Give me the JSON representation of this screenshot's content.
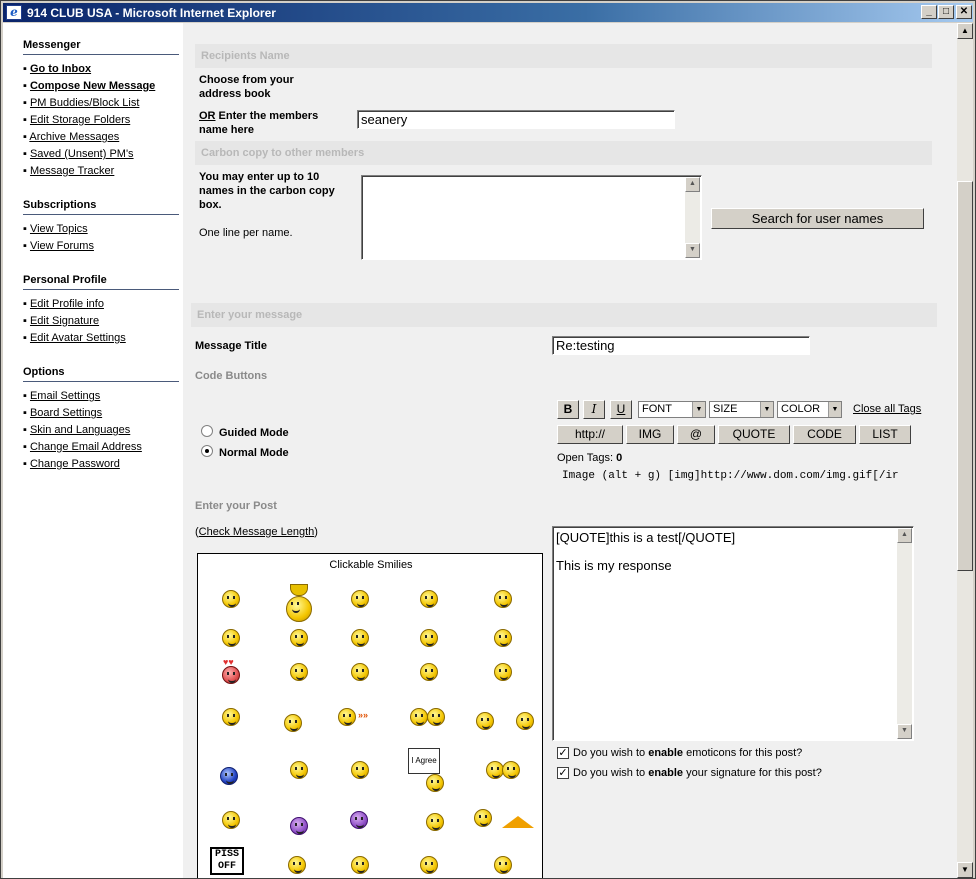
{
  "window": {
    "title": "914 CLUB USA - Microsoft Internet Explorer",
    "min": "_",
    "max": "□",
    "close": "✕"
  },
  "sidebar": {
    "sections": [
      {
        "heading": "Messenger",
        "items": [
          "Go to Inbox",
          "Compose New Message",
          "PM Buddies/Block List",
          "Edit Storage Folders",
          "Archive Messages",
          "Saved (Unsent) PM's",
          "Message Tracker"
        ]
      },
      {
        "heading": "Subscriptions",
        "items": [
          "View Topics",
          "View Forums"
        ]
      },
      {
        "heading": "Personal Profile",
        "items": [
          "Edit Profile info",
          "Edit Signature",
          "Edit Avatar Settings"
        ]
      },
      {
        "heading": "Options",
        "items": [
          "Email Settings",
          "Board Settings",
          "Skin and Languages",
          "Change Email Address",
          "Change Password"
        ]
      }
    ]
  },
  "recipients": {
    "bar": "Recipients Name",
    "choose_line1": "Choose from your",
    "choose_line2": "address book",
    "or": "OR",
    "enter_line1": " Enter the members",
    "enter_line2": "name here",
    "name_value": "seanery"
  },
  "carbon": {
    "bar": "Carbon copy to other members",
    "line1": "You may enter up to 10",
    "line2": "names in the carbon copy",
    "line3": "box.",
    "note": "One line per name.",
    "search_button": "Search for user names"
  },
  "message": {
    "bar": "Enter your message",
    "title_label": "Message Title",
    "title_value": "Re:testing",
    "code_buttons_label": "Code Buttons",
    "guided_mode": "Guided Mode",
    "normal_mode": "Normal Mode",
    "toolbar": {
      "bold": "B",
      "italic": "I",
      "underline": "U",
      "font": "FONT",
      "size": "SIZE",
      "color": "COLOR",
      "close_all": "Close all Tags",
      "http": "http://",
      "img": "IMG",
      "at": "@",
      "quote": "QUOTE",
      "code": "CODE",
      "list": "LIST"
    },
    "open_tags_label": "Open Tags:",
    "open_tags_count": "0",
    "help_text": "Image (alt + g) [img]http://www.dom.com/img.gif[/ir",
    "enter_post_label": "Enter your Post",
    "check_length": "Check Message Length",
    "post_line1": "[QUOTE]this is a test[/QUOTE]",
    "post_line2": "This is my response",
    "opt_emoticons_pre": "Do you wish to ",
    "opt_enable": "enable",
    "opt_emoticons_post": " emoticons for this post?",
    "opt_signature_post": " your signature for this post?"
  },
  "smilies": {
    "title": "Clickable Smilies",
    "agree_sign": "I Agree",
    "piss_off_1": "PISS",
    "piss_off_2": "OFF"
  }
}
